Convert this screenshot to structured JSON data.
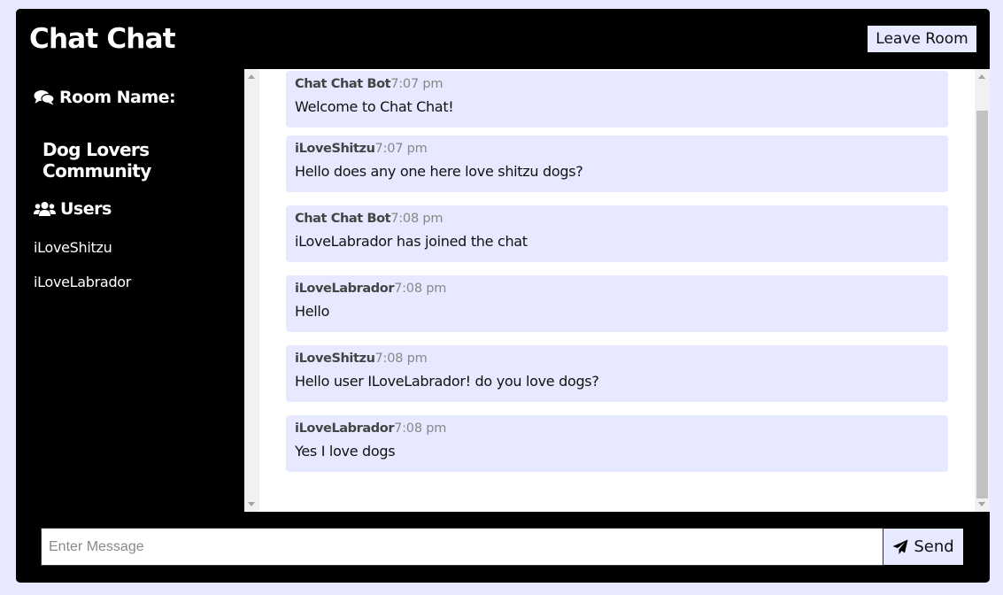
{
  "header": {
    "title": "Chat Chat",
    "leave_label": "Leave Room"
  },
  "sidebar": {
    "room_heading": "Room Name:",
    "room_name": "Dog Lovers Community",
    "users_heading": "Users",
    "users": [
      "iLoveShitzu",
      "iLoveLabrador"
    ]
  },
  "messages": [
    {
      "user": "Chat Chat Bot",
      "time": "7:07 pm",
      "text": "Welcome to Chat Chat!"
    },
    {
      "user": "iLoveShitzu",
      "time": "7:07 pm",
      "text": "Hello does any one here love shitzu dogs?"
    },
    {
      "user": "Chat Chat Bot",
      "time": "7:08 pm",
      "text": "iLoveLabrador has joined the chat"
    },
    {
      "user": "iLoveLabrador",
      "time": "7:08 pm",
      "text": "Hello"
    },
    {
      "user": "iLoveShitzu",
      "time": "7:08 pm",
      "text": "Hello user ILoveLabrador! do you love dogs?"
    },
    {
      "user": "iLoveLabrador",
      "time": "7:08 pm",
      "text": "Yes I love dogs"
    }
  ],
  "composer": {
    "placeholder": "Enter Message",
    "value": "",
    "send_label": "Send"
  },
  "colors": {
    "accent": "#e6e9ff",
    "background": "#000000",
    "timestamp": "#888888"
  },
  "icons": {
    "room": "comments-icon",
    "users": "users-icon",
    "send": "paper-plane-icon"
  }
}
